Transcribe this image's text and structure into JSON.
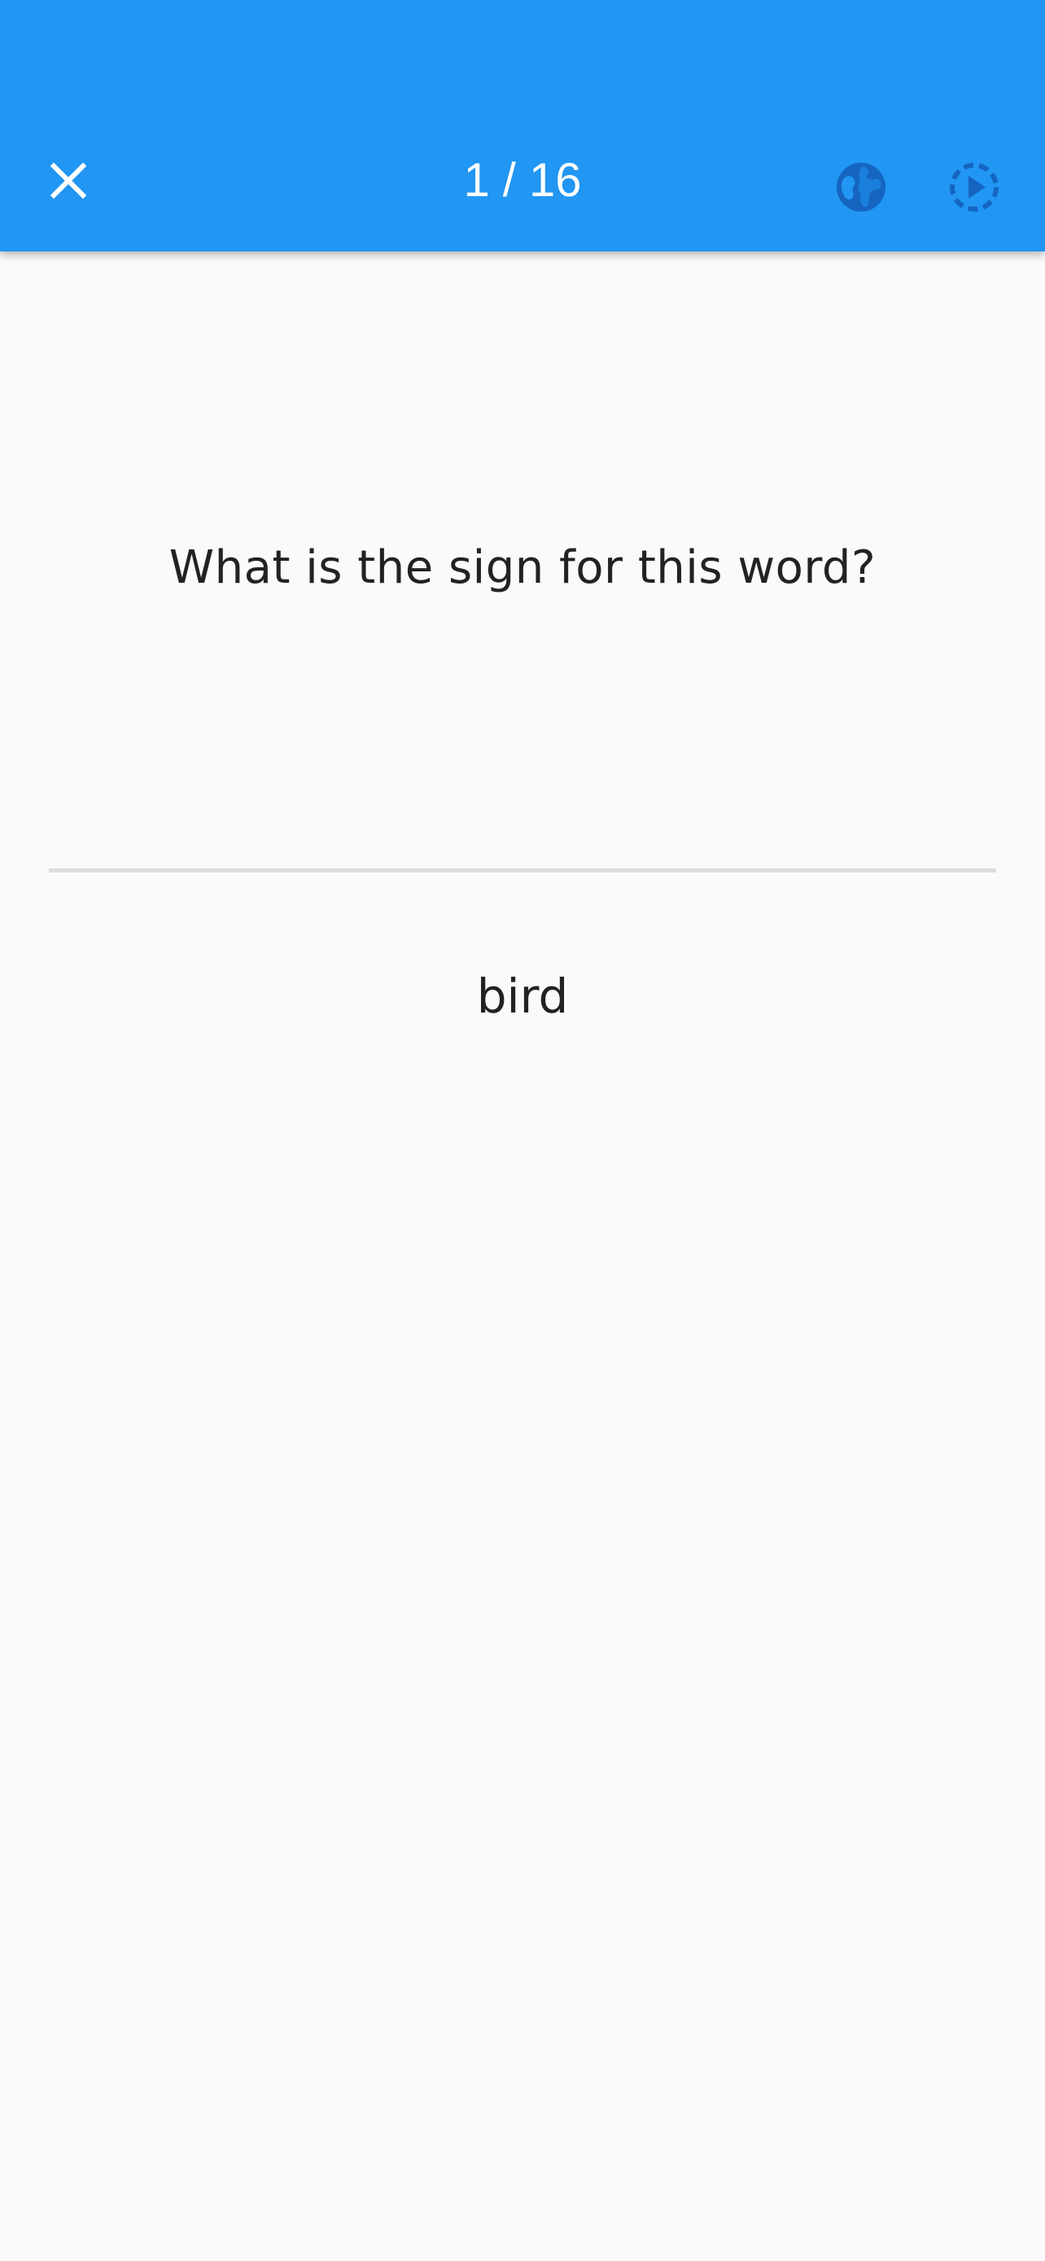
{
  "colors": {
    "app_bar": "#2196f3",
    "app_bar_icon_dark": "#1565c0",
    "background": "#fafafa",
    "text": "#222222",
    "divider": "#dddddd"
  },
  "app_bar": {
    "counter": "1 / 16",
    "close_icon": "close-icon",
    "globe_icon": "globe-icon",
    "play_icon": "slideshow-play-icon"
  },
  "card": {
    "question": "What is the sign for this word?",
    "word": "bird"
  }
}
